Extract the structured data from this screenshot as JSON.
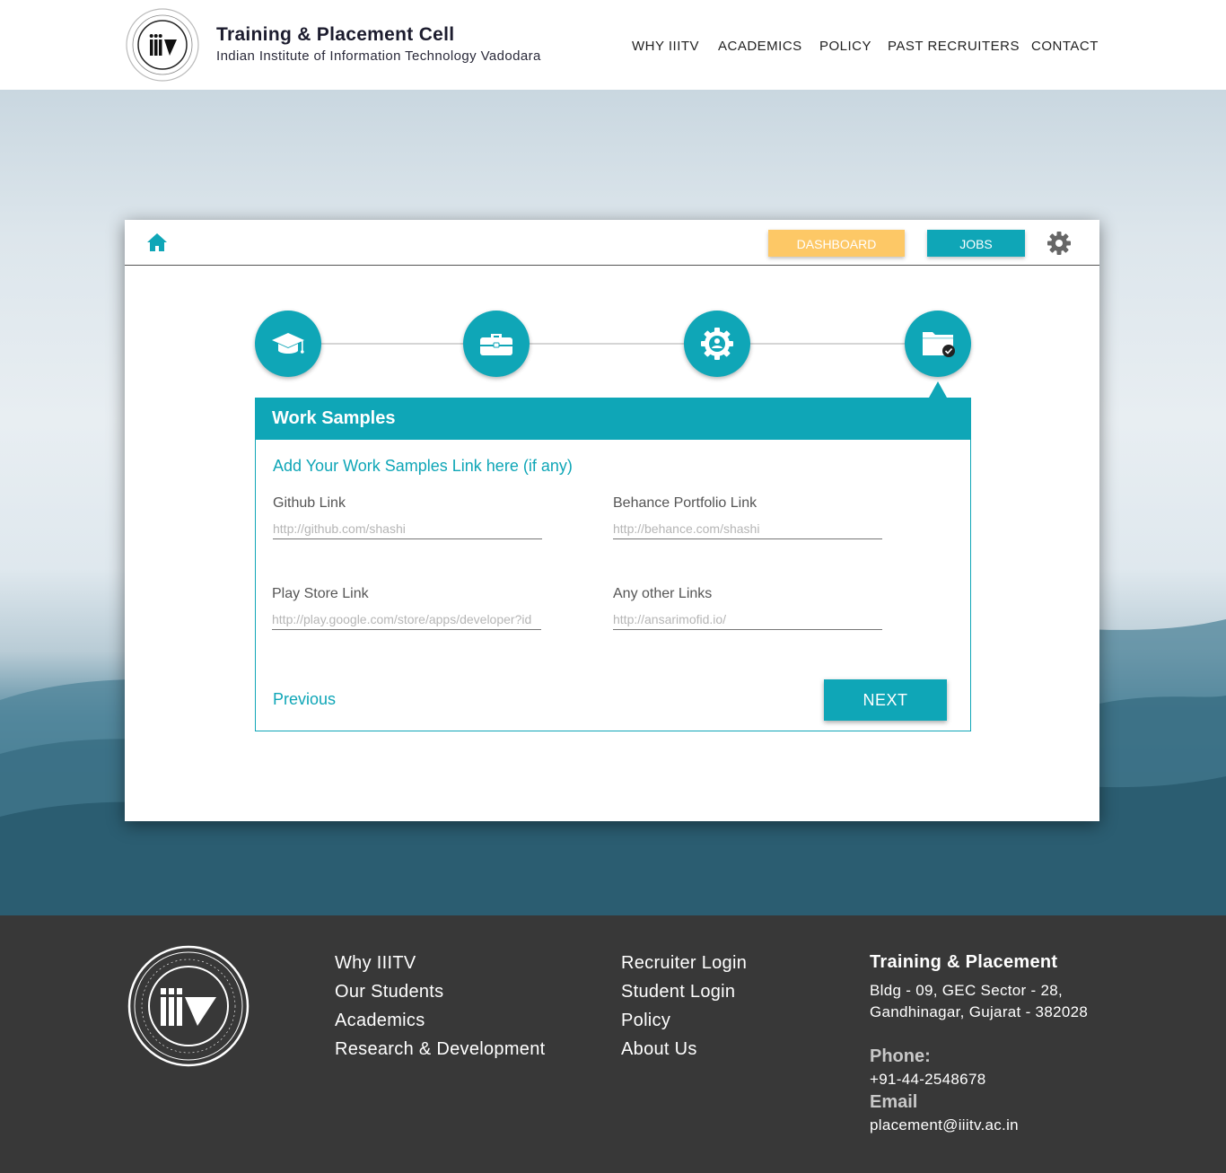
{
  "header": {
    "title": "Training & Placement Cell",
    "subtitle": "Indian Institute of Information Technology Vadodara",
    "logo_text": "iiiTV",
    "nav": [
      "WHY IIITV",
      "ACADEMICS",
      "POLICY",
      "PAST RECRUITERS",
      "CONTACT"
    ]
  },
  "toolbar": {
    "dashboard_label": "DASHBOARD",
    "jobs_label": "JOBS",
    "home_icon": "home-icon",
    "settings_icon": "gear-icon"
  },
  "stepper": {
    "steps": [
      {
        "icon": "graduation-cap-icon"
      },
      {
        "icon": "briefcase-icon"
      },
      {
        "icon": "user-gear-icon"
      },
      {
        "icon": "folder-check-icon"
      }
    ],
    "active_step": 4
  },
  "form": {
    "title": "Work Samples",
    "subtitle": "Add Your Work Samples Link here (if any)",
    "fields": [
      {
        "label": "Github Link",
        "value": "",
        "placeholder": "http://github.com/shashi"
      },
      {
        "label": "Behance Portfolio Link",
        "value": "",
        "placeholder": "http://behance.com/shashi"
      },
      {
        "label": "Play Store Link",
        "value": "",
        "placeholder": "http://play.google.com/store/apps/developer?id"
      },
      {
        "label": "Any other Links",
        "value": "",
        "placeholder": "http://ansarimofid.io/"
      }
    ],
    "previous_label": "Previous",
    "next_label": "NEXT"
  },
  "footer": {
    "col1": [
      "Why IIITV",
      "Our Students",
      "Academics",
      "Research & Development"
    ],
    "col2": [
      "Recruiter Login",
      "Student Login",
      "Policy",
      "About Us"
    ],
    "contact": {
      "heading": "Training & Placement",
      "address_line1": "Bldg - 09, GEC Sector - 28,",
      "address_line2": "Gandhinagar, Gujarat - 382028",
      "phone_label": "Phone:",
      "phone": "+91-44-2548678",
      "email_label": "Email",
      "email": "placement@iiitv.ac.in"
    }
  },
  "colors": {
    "accent": "#0fa6b7",
    "dashboard": "#fdc866",
    "footer_bg": "#383838"
  }
}
